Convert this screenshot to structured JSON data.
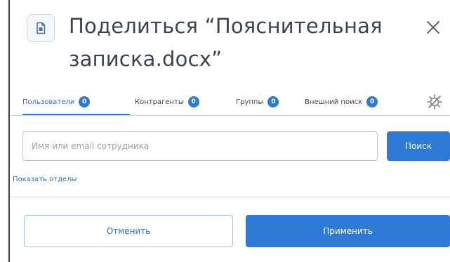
{
  "dialog": {
    "title": "Поделиться “Пояснительная записка.docx”",
    "close_icon": "close-icon",
    "file_icon": "document-icon"
  },
  "tabs": [
    {
      "label": "Пользователи",
      "count": "0",
      "active": true
    },
    {
      "label": "Контрагенты",
      "count": "0",
      "active": false
    },
    {
      "label": "Группы",
      "count": "0",
      "active": false
    },
    {
      "label": "Внешний поиск",
      "count": "0",
      "active": false
    }
  ],
  "tabs_settings_icon": "settings-off-icon",
  "search": {
    "placeholder": "Имя или email сотрудника",
    "value": "",
    "button_label": "Поиск"
  },
  "show_departments_label": "Показать отделы",
  "footer": {
    "cancel_label": "Отменить",
    "apply_label": "Применить"
  },
  "colors": {
    "accent": "#2f7ad6",
    "text": "#3b4350",
    "border": "#b7c4d8"
  }
}
